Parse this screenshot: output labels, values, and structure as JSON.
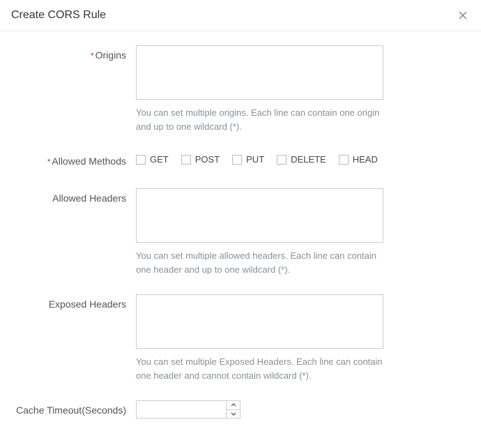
{
  "header": {
    "title": "Create CORS Rule"
  },
  "form": {
    "origins": {
      "label": "Origins",
      "required": true,
      "value": "",
      "description": "You can set multiple origins. Each line can contain one origin and up to one wildcard (*)."
    },
    "allowedMethods": {
      "label": "Allowed Methods",
      "required": true,
      "options": [
        {
          "label": "GET",
          "checked": false
        },
        {
          "label": "POST",
          "checked": false
        },
        {
          "label": "PUT",
          "checked": false
        },
        {
          "label": "DELETE",
          "checked": false
        },
        {
          "label": "HEAD",
          "checked": false
        }
      ]
    },
    "allowedHeaders": {
      "label": "Allowed Headers",
      "required": false,
      "value": "",
      "description": "You can set multiple allowed headers. Each line can contain one header and up to one wildcard (*)."
    },
    "exposedHeaders": {
      "label": "Exposed Headers",
      "required": false,
      "value": "",
      "description": "You can set multiple Exposed Headers. Each line can contain one header and cannot contain wildcard (*)."
    },
    "cacheTimeout": {
      "label": "Cache Timeout(Seconds)",
      "required": false,
      "value": ""
    }
  }
}
